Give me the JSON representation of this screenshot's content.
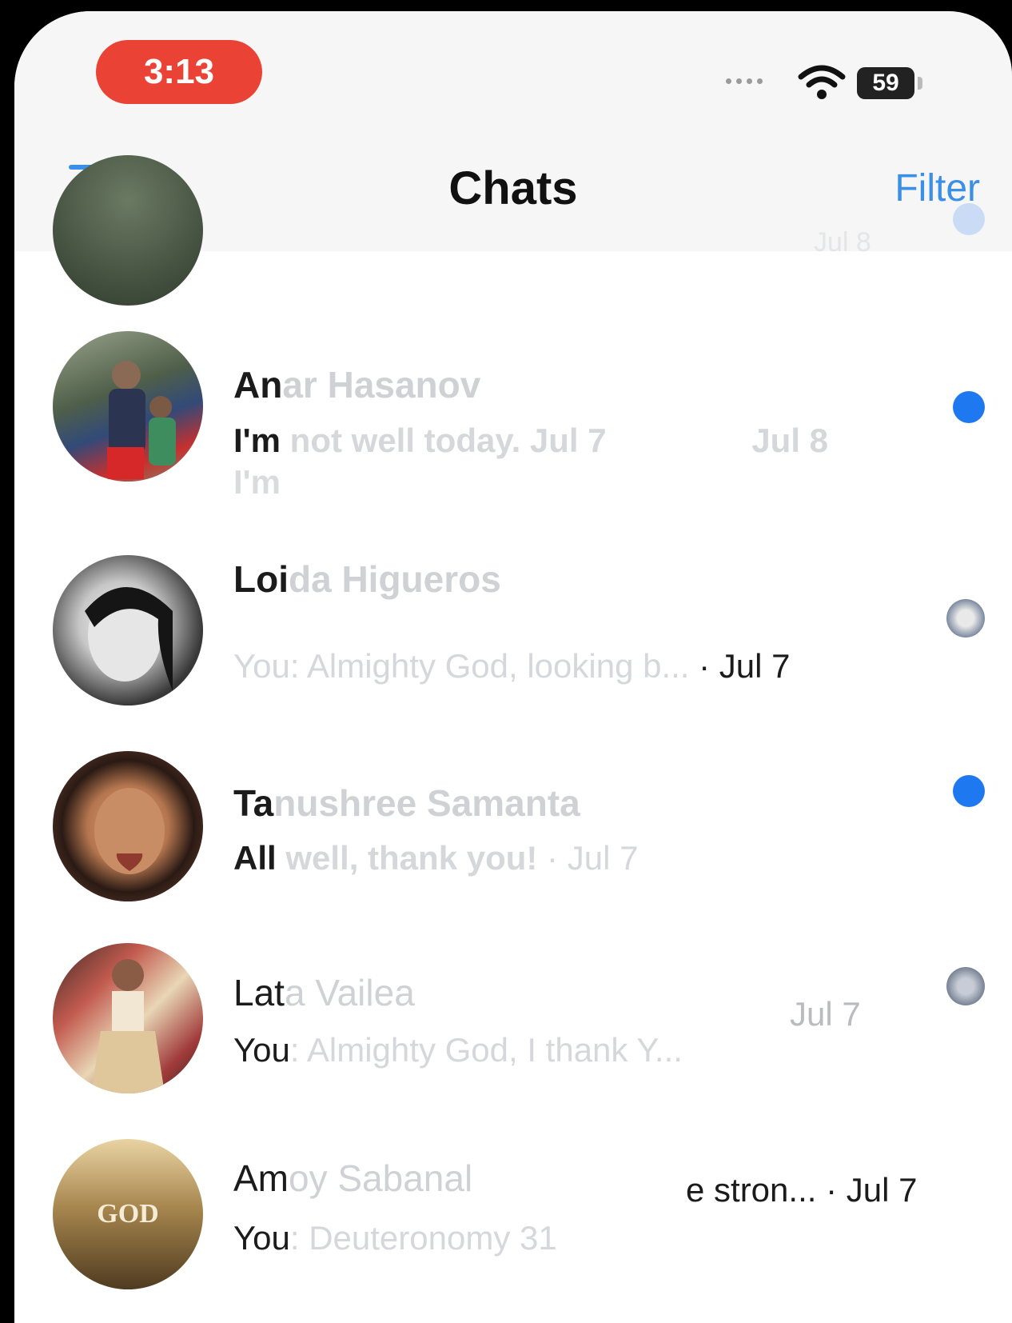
{
  "status": {
    "time": "3:13",
    "battery": "59"
  },
  "header": {
    "title": "Chats",
    "filter_label": "Filter"
  },
  "top_partial": {
    "date": "Jul 8"
  },
  "chats": [
    {
      "name_bold": "An",
      "name_faded": "ar Hasanov",
      "preview_bold": "I'm",
      "preview_faded": " not well today.",
      "ghost_preview": "I'm",
      "ghost_date": "Jul 7",
      "ghost_date2": "Jul 8"
    },
    {
      "name_bold": "Loi",
      "name_faded": "da Higueros",
      "preview_bold": "You",
      "preview_faded": ": Almighty God, looking b...",
      "date": " · Jul 7"
    },
    {
      "name_bold": "Ta",
      "name_faded": "nushree Samanta",
      "preview_bold": "All",
      "preview_faded": " well, thank you!",
      "date_faded": " · Jul 7"
    },
    {
      "name_bold": "Lat",
      "name_faded": "a Vailea",
      "preview_bold": "You",
      "preview_faded": ": Almighty God, I thank Y...",
      "date_faded": "Jul 7"
    },
    {
      "name_bold": "Am",
      "name_faded": "oy Sabanal",
      "preview_bold": "You",
      "preview_faded": ": Deuteronomy 31",
      "extra": "e stron...",
      "date": " · Jul 7",
      "avatar_text": "GOD"
    }
  ]
}
